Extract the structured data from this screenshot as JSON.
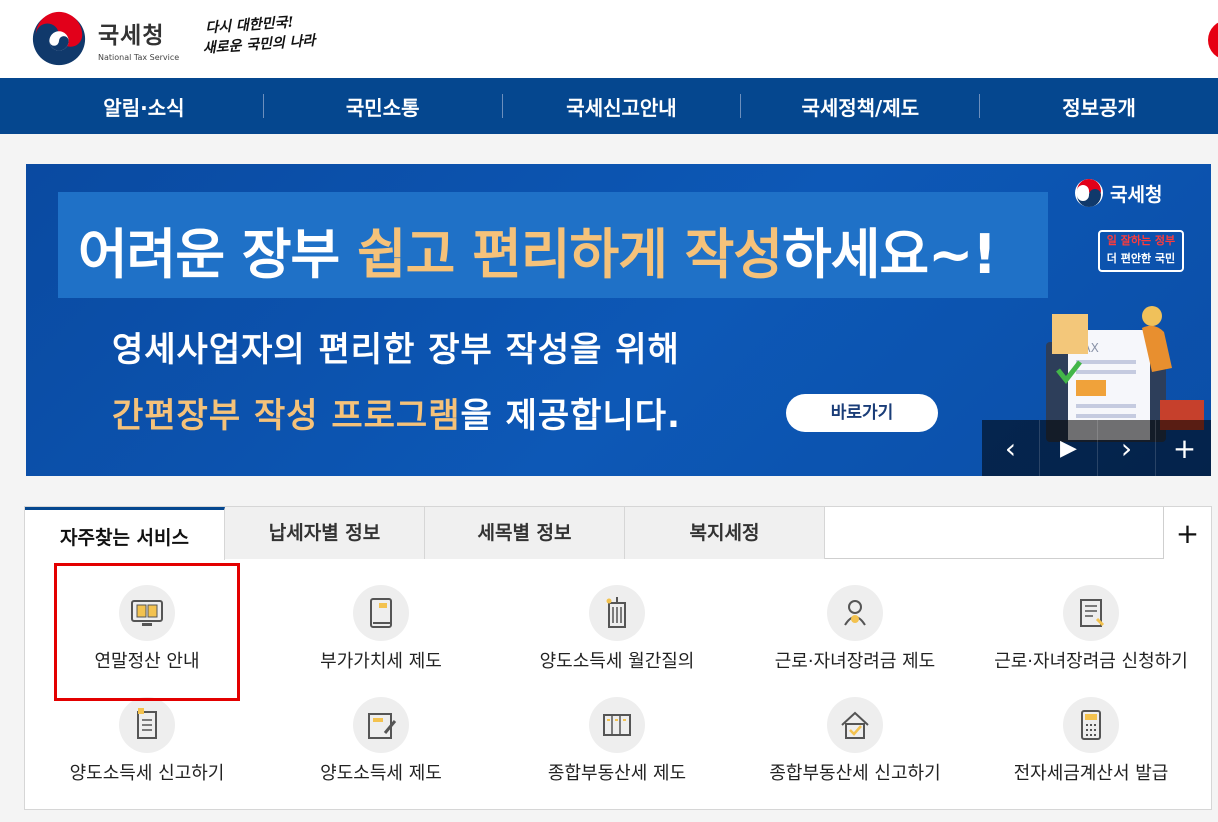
{
  "header": {
    "logo_ko": "국세청",
    "logo_en": "National Tax Service",
    "slogan_line1": "다시 대한민국!",
    "slogan_line2": "새로운 국민의 나라"
  },
  "gnb": {
    "items": [
      {
        "label": "알림·소식"
      },
      {
        "label": "국민소통"
      },
      {
        "label": "국세신고안내"
      },
      {
        "label": "국세정책/제도"
      },
      {
        "label": "정보공개"
      }
    ]
  },
  "banner": {
    "title_a": "어려운 장부 ",
    "title_hl": "쉽고 편리하게 작성",
    "title_b": "하세요~!",
    "line1": "영세사업자의 편리한 장부 작성을 위해",
    "line2_hl": "간편장부 작성 프로그램",
    "line2_b": "을 제공합니다.",
    "go_label": "바로가기",
    "brand": "국세청",
    "stamp_a": "일 잘하는 정부",
    "stamp_b": "더 편안한 국민",
    "illus_text": "TAX",
    "controls": {
      "prev": "‹",
      "play": "▶",
      "next": "›",
      "more": "+"
    }
  },
  "tabs": {
    "items": [
      {
        "label": "자주찾는 서비스"
      },
      {
        "label": "납세자별 정보"
      },
      {
        "label": "세목별 정보"
      },
      {
        "label": "복지세정"
      }
    ],
    "more": "+"
  },
  "services": [
    {
      "label": "연말정산 안내",
      "icon": "monitor-book-icon"
    },
    {
      "label": "부가가치세 제도",
      "icon": "book-icon"
    },
    {
      "label": "양도소득세 월간질의",
      "icon": "building-icon"
    },
    {
      "label": "근로·자녀장려금 제도",
      "icon": "people-icon"
    },
    {
      "label": "근로·자녀장려금 신청하기",
      "icon": "document-pen-icon"
    },
    {
      "label": "양도소득세 신고하기",
      "icon": "document-icon"
    },
    {
      "label": "양도소득세 제도",
      "icon": "notebook-pen-icon"
    },
    {
      "label": "종합부동산세 제도",
      "icon": "cabinet-icon"
    },
    {
      "label": "종합부동산세 신고하기",
      "icon": "house-check-icon"
    },
    {
      "label": "전자세금계산서 발급",
      "icon": "calculator-icon"
    }
  ],
  "colors": {
    "nav": "#05478f",
    "banner": "#0d58b6",
    "highlight_yellow": "#f5c27a",
    "selection_box": "#e30000"
  }
}
